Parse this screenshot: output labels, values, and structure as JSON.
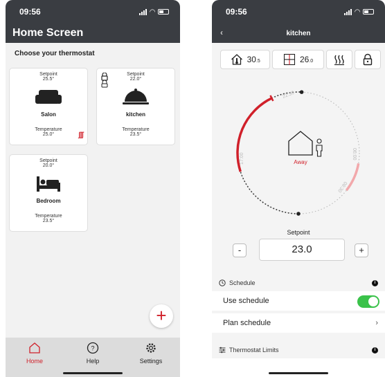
{
  "screen1": {
    "status": {
      "time": "09:56"
    },
    "header_title": "Home Screen",
    "subtitle": "Choose your thermostat",
    "cards": [
      {
        "setpoint_label": "Setpoint",
        "setpoint": "25.5°",
        "name": "Salon",
        "temp_label": "Temperature",
        "temp": "25.0°",
        "icon": "sofa-icon",
        "heating": true
      },
      {
        "setpoint_label": "Setpoint",
        "setpoint": "22.0°",
        "name": "kitchen",
        "temp_label": "Temperature",
        "temp": "23.5°",
        "icon": "cloche-icon",
        "locked": true
      },
      {
        "setpoint_label": "Setpoint",
        "setpoint": "20.0°",
        "name": "Bedroom",
        "temp_label": "Temperature",
        "temp": "23.5°",
        "icon": "bed-icon"
      }
    ],
    "fab_label": "+",
    "tabs": [
      {
        "label": "Home",
        "icon": "home-icon",
        "active": true
      },
      {
        "label": "Help",
        "icon": "help-icon"
      },
      {
        "label": "Settings",
        "icon": "gear-icon"
      }
    ]
  },
  "screen2": {
    "status": {
      "time": "09:56"
    },
    "header_title": "kitchen",
    "back_label": "‹",
    "chips": {
      "indoor_int": "30",
      "indoor_dec": ".5",
      "floor_int": "26",
      "floor_dec": ".0"
    },
    "dial": {
      "mode_label": "Away",
      "tick_labels": [
        "22:30",
        "06:00",
        "08:30",
        "17:00"
      ],
      "active_color": "#d0202a",
      "secondary_color": "#f2a8ab"
    },
    "setpoint_label": "Setpoint",
    "setpoint_value": "23.0",
    "minus_label": "-",
    "plus_label": "+",
    "schedule_section": "Schedule",
    "use_schedule_label": "Use schedule",
    "use_schedule_on": true,
    "plan_schedule_label": "Plan schedule",
    "chevron_label": "›",
    "limits_section": "Thermostat Limits",
    "info_label": "i"
  },
  "colors": {
    "accent": "#d0202a",
    "header": "#3a3d42",
    "toggle_on": "#3ac24a"
  }
}
